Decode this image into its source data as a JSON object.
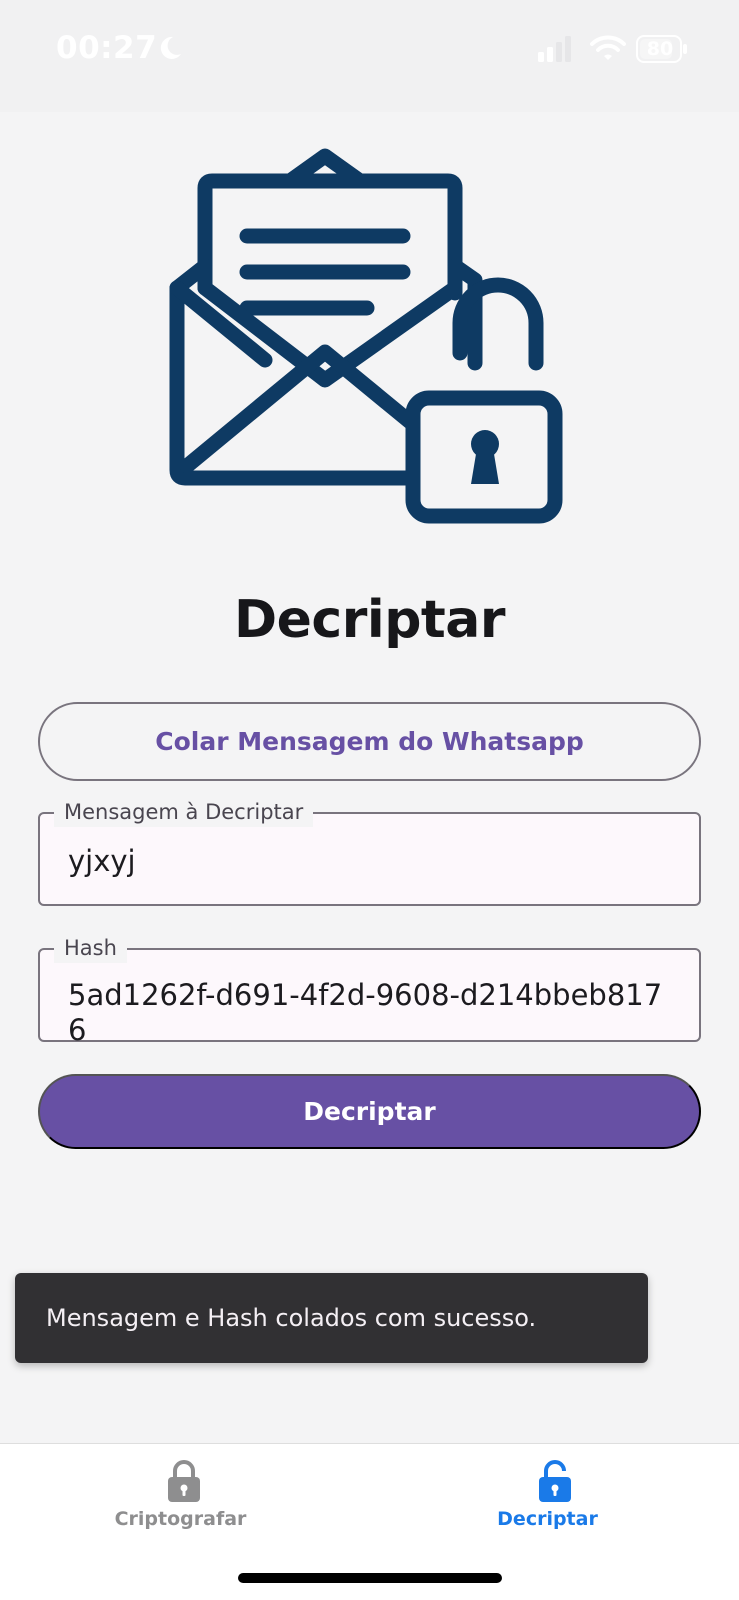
{
  "status_bar": {
    "time": "00:27",
    "battery": "80",
    "icons": [
      "moon-icon",
      "signal-icon",
      "wifi-icon",
      "battery-icon"
    ]
  },
  "hero": {
    "icon": "open-envelope-unlocked-padlock-icon",
    "color": "#0e3a63"
  },
  "page": {
    "title": "Decriptar"
  },
  "actions": {
    "paste_label": "Colar Mensagem do Whatsapp",
    "decrypt_label": "Decriptar"
  },
  "form": {
    "message": {
      "label": "Mensagem à Decriptar",
      "value": "yjxyj"
    },
    "hash": {
      "label": "Hash",
      "value": "5ad1262f-d691-4f2d-9608-d214bbeb8176"
    }
  },
  "snackbar": {
    "text": "Mensagem e Hash colados com sucesso."
  },
  "tab_bar": {
    "tabs": [
      {
        "label": "Criptografar",
        "icon": "lock-closed-icon",
        "active": false
      },
      {
        "label": "Decriptar",
        "icon": "lock-open-icon",
        "active": true
      }
    ]
  },
  "colors": {
    "accent": "#6750a4",
    "active_tab": "#1a7ae8",
    "inactive_tab": "#8e8e8f",
    "snackbar_bg": "#313033"
  }
}
